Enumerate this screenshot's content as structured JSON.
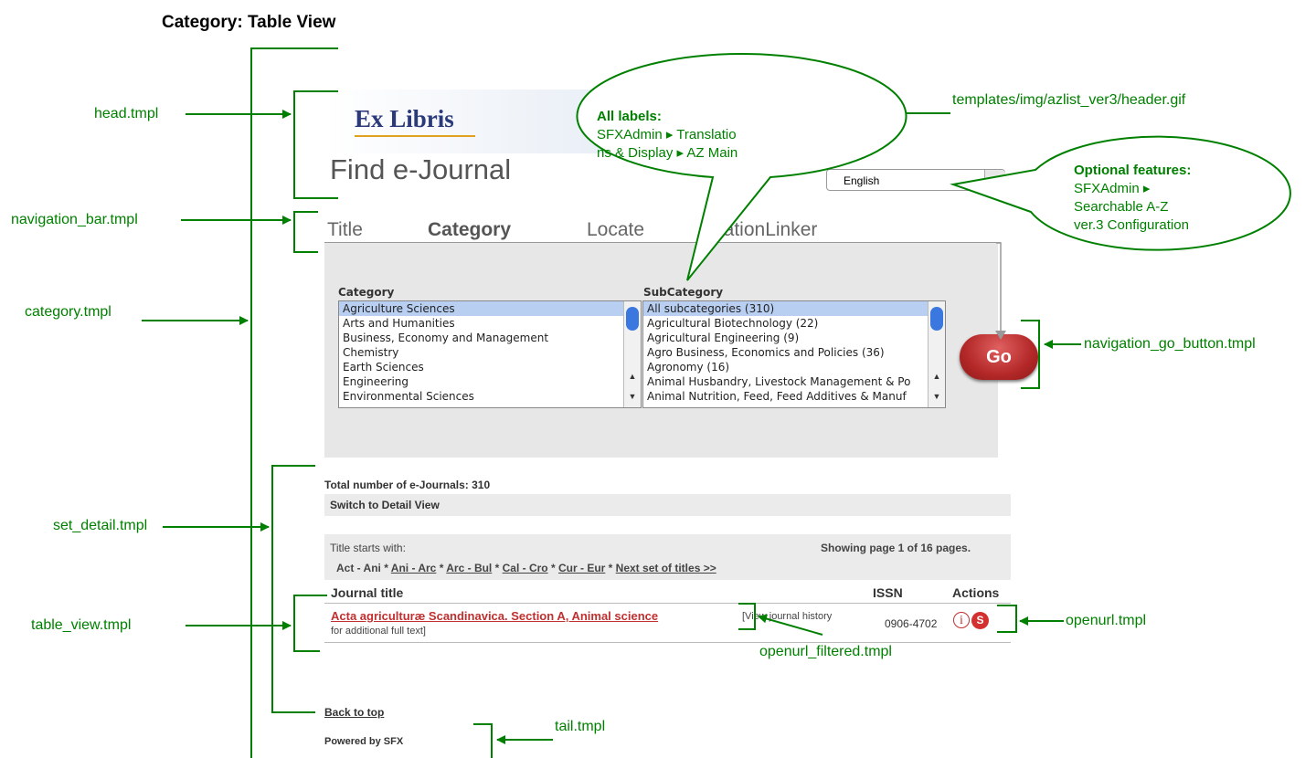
{
  "title": "Category: Table View",
  "annotations": {
    "head": "head.tmpl",
    "navigation_bar": "navigation_bar.tmpl",
    "category": "category.tmpl",
    "set_detail": "set_detail.tmpl",
    "table_view": "table_view.tmpl",
    "header_gif": "templates/img/azlist_ver3/header.gif",
    "go_button": "navigation_go_button.tmpl",
    "openurl": "openurl.tmpl",
    "openurl_filtered": "openurl_filtered.tmpl",
    "tail": "tail.tmpl"
  },
  "callouts": {
    "labels": {
      "heading": "All labels:",
      "line1": "SFXAdmin ▸ Translatio",
      "line2": "ns & Display ▸ AZ Main"
    },
    "optional": {
      "heading": "Optional features:",
      "line1": "SFXAdmin ▸",
      "line2": "Searchable A-Z",
      "line3": "ver.3 Configuration"
    }
  },
  "ui": {
    "logo": "Ex Libris",
    "find_title": "Find e-Journal",
    "language": "English",
    "tabs": [
      {
        "label": "Title"
      },
      {
        "label": "Category"
      },
      {
        "label": "Locate"
      },
      {
        "label": "CitationLinker"
      }
    ],
    "category_label": "Category",
    "subcategory_label": "SubCategory",
    "categories": [
      "Agriculture Sciences",
      "Arts and Humanities",
      "Business, Economy and Management",
      "Chemistry",
      "Earth Sciences",
      "Engineering",
      "Environmental Sciences"
    ],
    "subcategories": [
      "All subcategories (310)",
      "Agricultural Biotechnology (22)",
      "Agricultural Engineering (9)",
      "Agro Business, Economics and Policies (36)",
      "Agronomy (16)",
      "Animal Husbandry, Livestock Management & Po",
      "Animal Nutrition, Feed, Feed Additives & Manuf"
    ],
    "go_label": "Go",
    "total": "Total number of e-Journals: 310",
    "switch_view": "Switch to Detail View",
    "title_starts": "Title starts with:",
    "showing": "Showing page 1 of 16 pages.",
    "range_current": "Act - Ani",
    "sep": " * ",
    "ranges": [
      "Ani - Arc",
      "Arc - Bul",
      "Cal - Cro",
      "Cur - Eur",
      "Next set of titles >>"
    ],
    "col_title": "Journal title",
    "col_issn": "ISSN",
    "col_actions": "Actions",
    "journal_title": "Acta agriculturæ Scandinavica. Section A, Animal science",
    "journal_note1": "[View journal history",
    "journal_note2": "for additional full text]",
    "issn": "0906-4702",
    "info_glyph": "i",
    "sfx_glyph": "S",
    "back_to_top": "Back to top",
    "powered_by": "Powered by SFX"
  },
  "colors": {
    "annotation": "#008000",
    "go_button": "#b42828",
    "journal_link": "#c03030",
    "selection": "#b8cff2"
  }
}
